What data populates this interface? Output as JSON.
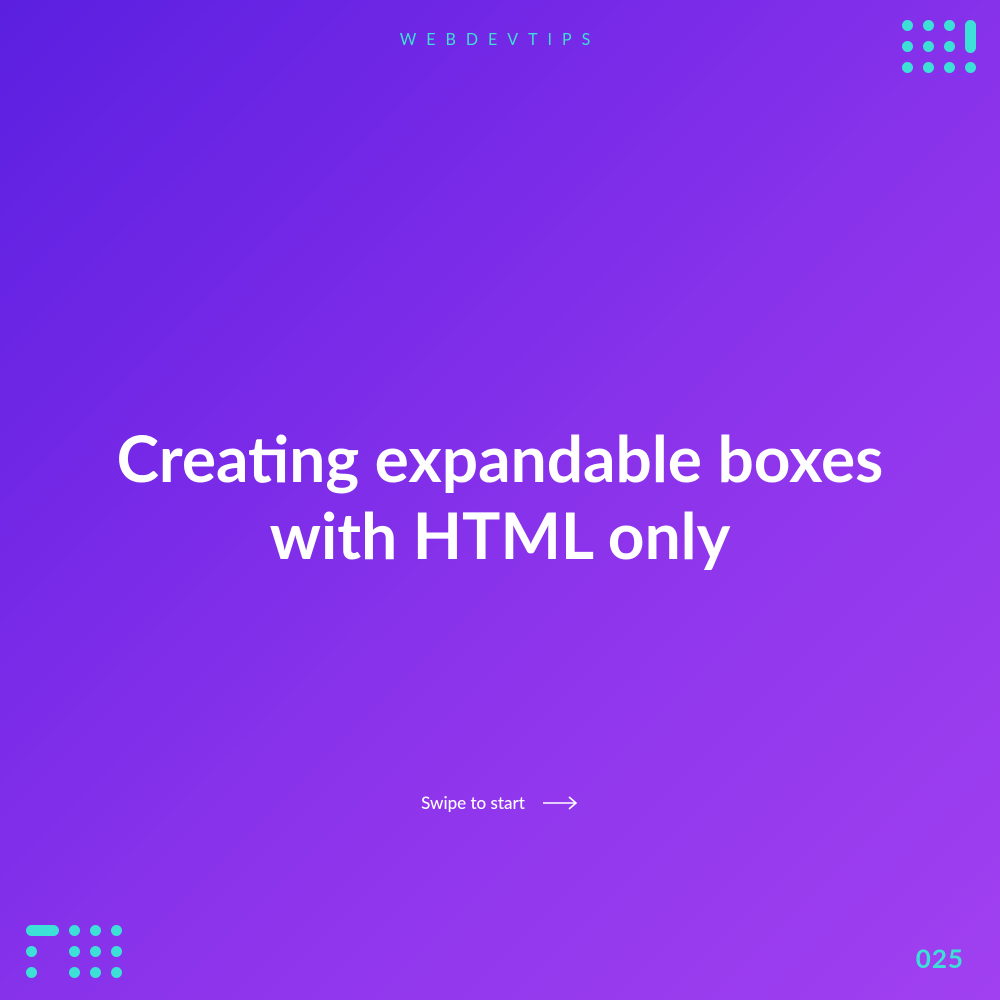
{
  "brand": "WEBDEVTIPS",
  "title": "Creating expandable boxes with HTML only",
  "cta_label": "Swipe to start",
  "page_number": "025",
  "colors": {
    "accent": "#3de0d6",
    "bg_gradient_from": "#5b1fe0",
    "bg_gradient_to": "#a040f0",
    "text": "#ffffff"
  }
}
